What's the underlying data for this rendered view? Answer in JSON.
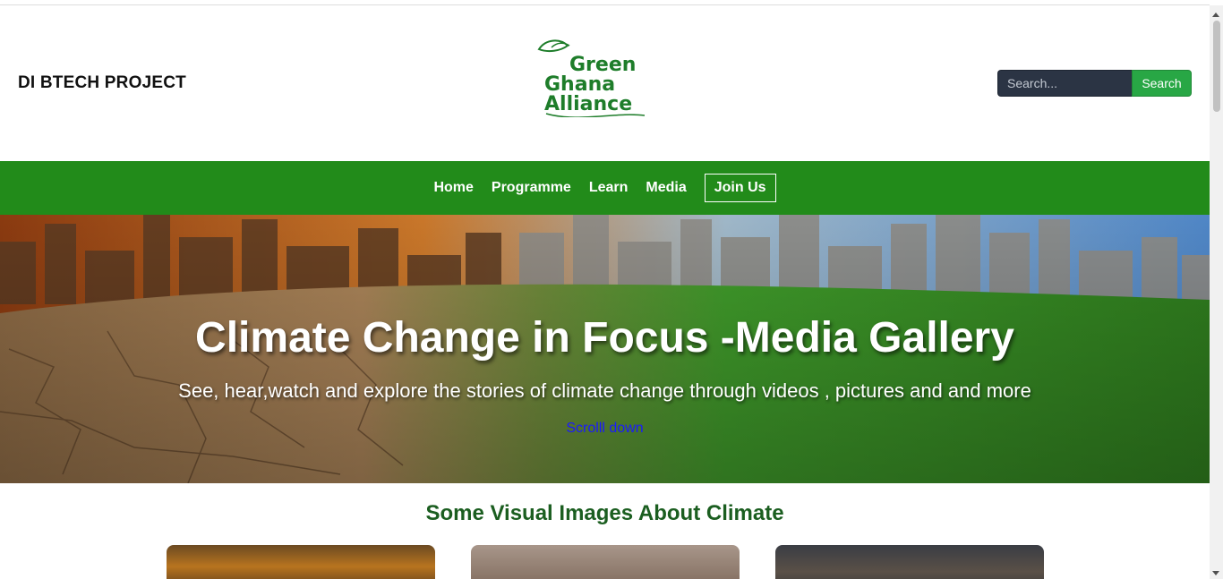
{
  "header": {
    "brand": "DI BTECH PROJECT",
    "logo": {
      "line1": "Green",
      "line2": "Ghana",
      "line3": "Alliance"
    },
    "search": {
      "placeholder": "Search...",
      "button_label": "Search"
    }
  },
  "nav": {
    "items": [
      {
        "label": "Home"
      },
      {
        "label": "Programme"
      },
      {
        "label": "Learn"
      },
      {
        "label": "Media"
      }
    ],
    "join_label": "Join Us"
  },
  "hero": {
    "title": "Climate Change in Focus -Media Gallery",
    "subtitle": "See, hear,watch and explore the stories of climate change through videos , pictures and and more",
    "link_label": "Scrolll down"
  },
  "gallery": {
    "title": "Some Visual Images About Climate"
  },
  "colors": {
    "nav_bg": "#228b1a",
    "search_btn": "#28a745",
    "section_title": "#1b5e20",
    "logo_green": "#1e7d2a"
  }
}
